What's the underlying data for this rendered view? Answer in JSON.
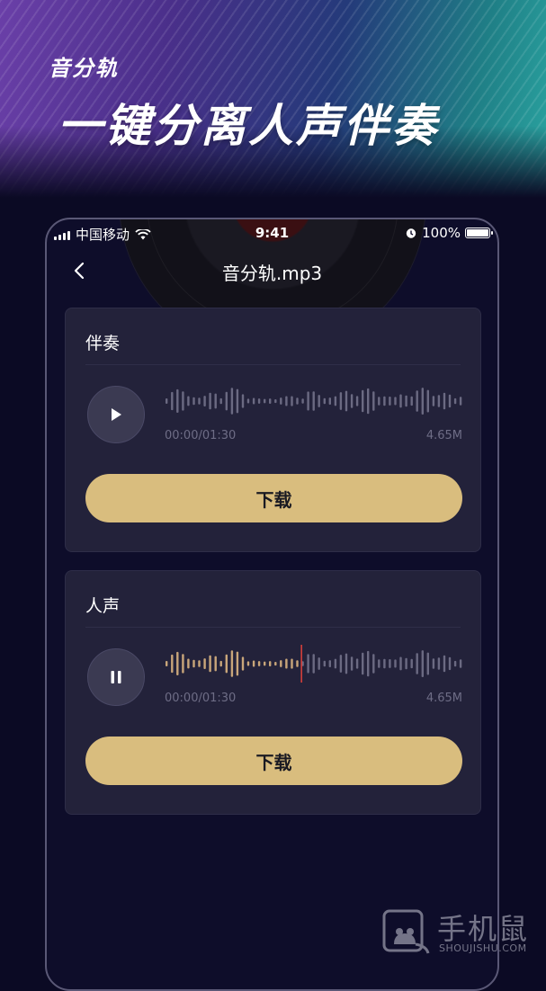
{
  "banner": {
    "brand": "音分轨",
    "headline": "一键分离人声伴奏"
  },
  "status_bar": {
    "carrier": "中国移动",
    "time": "9:41",
    "battery": "100%"
  },
  "nav": {
    "title": "音分轨.mp3"
  },
  "tracks": [
    {
      "title": "伴奏",
      "time": "00:00/01:30",
      "size": "4.65M",
      "state": "paused",
      "progress": 0,
      "download_label": "下载"
    },
    {
      "title": "人声",
      "time": "00:00/01:30",
      "size": "4.65M",
      "state": "playing",
      "progress": 0.45,
      "download_label": "下载"
    }
  ],
  "watermark": {
    "big": "手机鼠",
    "small": "SHOUJISHU.COM"
  },
  "colors": {
    "accent": "#d9bd7e",
    "played": "#c9a67a",
    "unplayed": "#6b6a82",
    "playhead": "#e0413b",
    "card": "#23223a",
    "background": "#0b0a24"
  }
}
